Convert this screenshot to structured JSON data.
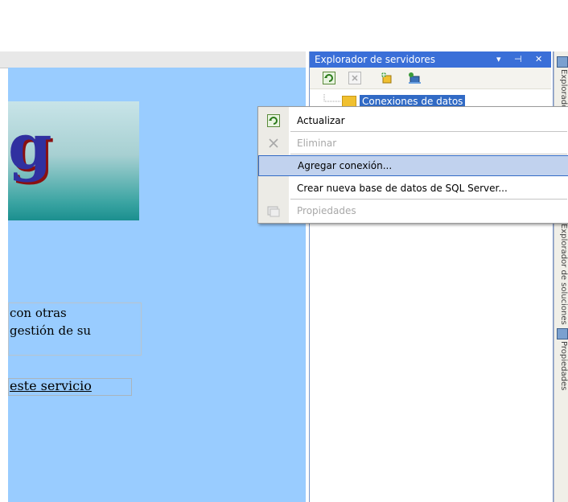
{
  "document": {
    "logo_letter": "g",
    "line1": "con otras",
    "line2": "gestión de su",
    "link": "este servicio"
  },
  "panel": {
    "title": "Explorador de servidores",
    "title_buttons": [
      "▾",
      "⊣",
      "✕"
    ],
    "tree_node": "Conexiones de datos"
  },
  "context_menu": {
    "items": [
      {
        "label": "Actualizar",
        "icon": "refresh-icon",
        "enabled": true
      },
      {
        "label": "Eliminar",
        "icon": "delete-x-icon",
        "enabled": false
      },
      {
        "label": "Agregar conexión...",
        "icon": "",
        "enabled": true,
        "highlighted": true
      },
      {
        "label": "Crear nueva base de datos de SQL Server...",
        "icon": "",
        "enabled": true
      },
      {
        "label": "Propiedades",
        "icon": "properties-icon",
        "enabled": false
      }
    ]
  },
  "side_tabs": {
    "tab1": "Explorador",
    "tab2": "Explorador de soluciones",
    "tab3": "Propiedades"
  },
  "colors": {
    "panel_title": "#3a6fd8",
    "doc_background": "#99ccff",
    "menu_highlight": "#c1d2ee"
  }
}
